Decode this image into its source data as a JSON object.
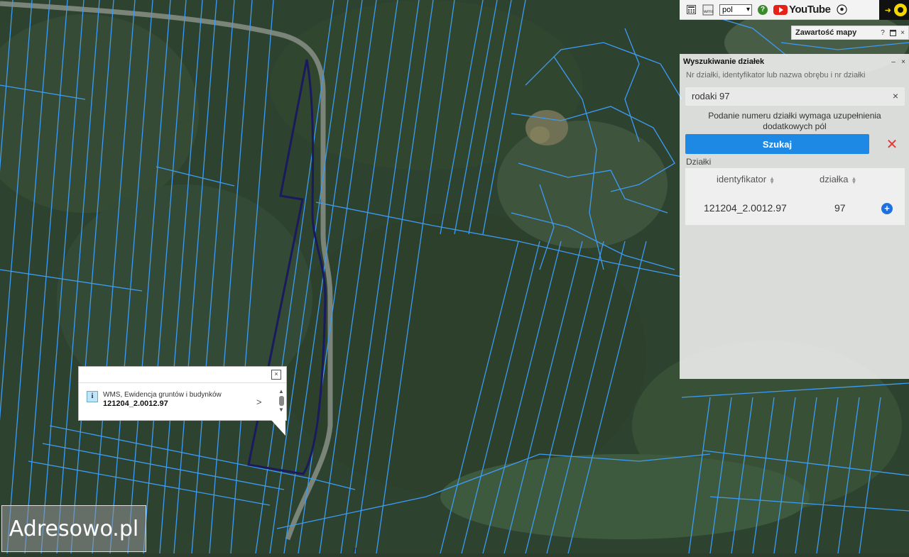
{
  "toolbar": {
    "language_value": "pol",
    "youtube_label": "YouTube",
    "icons": [
      "calculator-icon",
      "wms-icon",
      "help-icon",
      "youtube-icon",
      "soccer-ball-icon",
      "eye-icon"
    ]
  },
  "map_content": {
    "title": "Zawartość mapy",
    "help_label": "?",
    "close_label": "×"
  },
  "search_panel": {
    "title": "Wyszukiwanie działek",
    "hint": "Nr działki, identyfikator lub nazwa obrębu i nr działki",
    "query": "rodaki 97",
    "clear_label": "×",
    "requirement_note": "Podanie numeru działki wymaga uzupełnienia dodatkowych pól",
    "search_button": "Szukaj",
    "cancel_label": "✕",
    "results_label": "Działki",
    "columns": [
      "identyfikator",
      "działka"
    ],
    "rows": [
      {
        "identifier": "121204_2.0012.97",
        "parcel": "97"
      }
    ],
    "add_label": "+"
  },
  "popup": {
    "source": "WMS, Ewidencja gruntów i budynków",
    "parcel_id": "121204_2.0012.97",
    "close_label": "×",
    "info_label": "i",
    "more_label": ">"
  },
  "watermark": {
    "text": "Adresowo.pl"
  },
  "colors": {
    "parcel_lines": "#3d9cf5",
    "selected_parcel": "#1a1a5e",
    "accent_button": "#1e88e5",
    "forest": "#2e4230"
  }
}
